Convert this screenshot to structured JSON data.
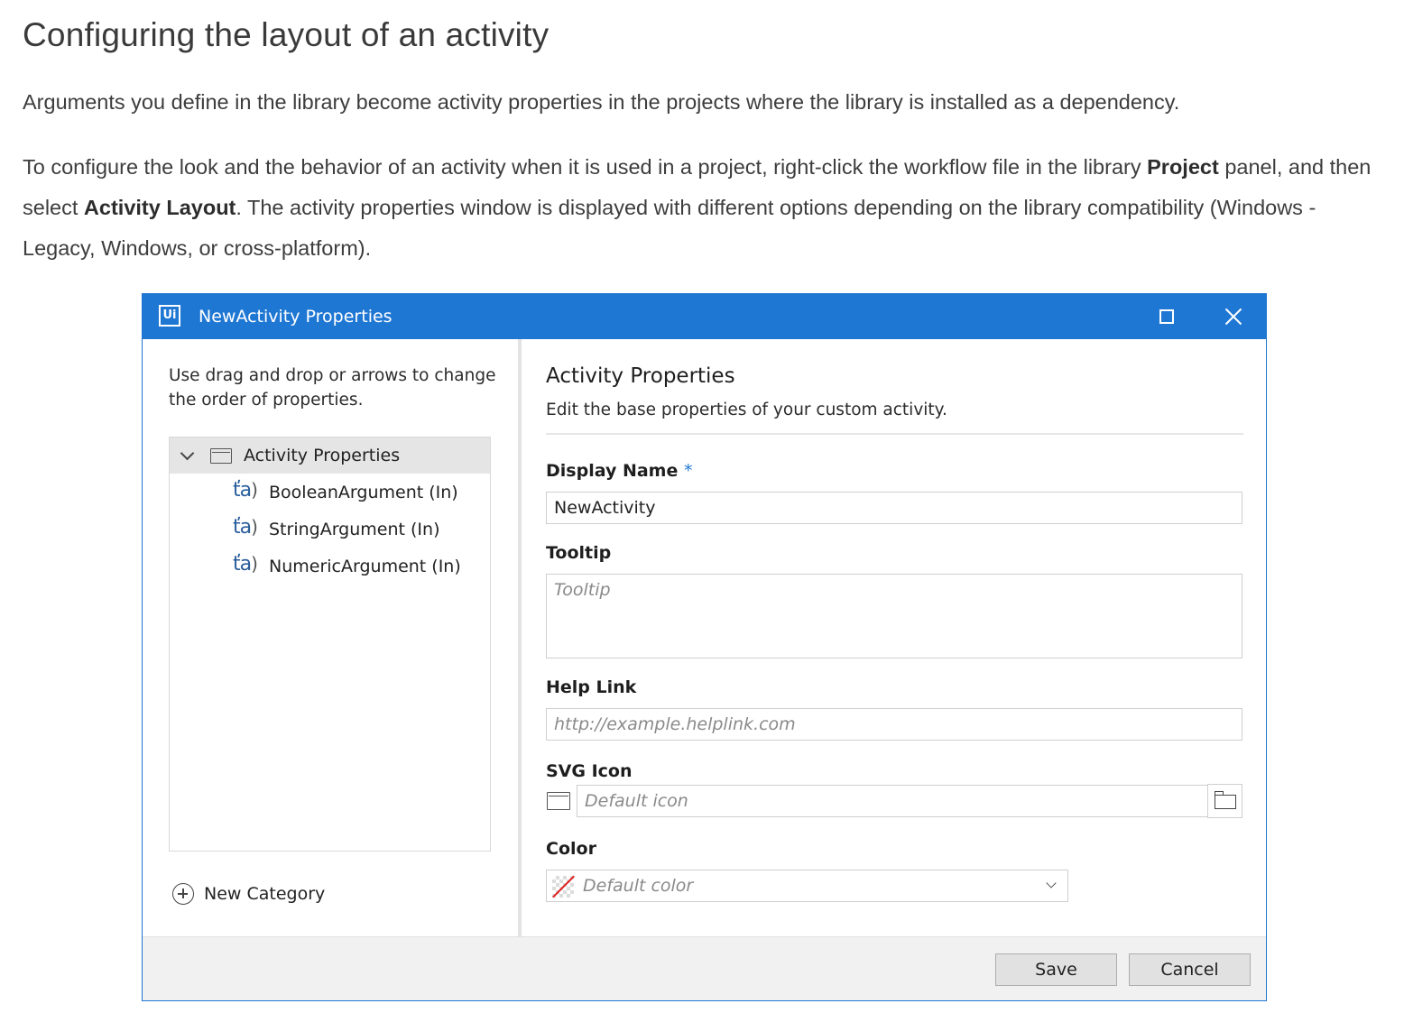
{
  "article": {
    "title": "Configuring the layout of an activity",
    "para1": "Arguments you define in the library become activity properties in the projects where the library is installed as a dependency.",
    "para2": {
      "text_a": "To configure the look and the behavior of an activity when it is used in a project, right-click the workflow file in the library ",
      "bold_a": "Project",
      "text_b": " panel, and then select ",
      "bold_b": "Activity Layout",
      "text_c": ". The activity properties window is displayed with different options depending on the library compatibility (Windows - Legacy, Windows, or cross-platform)."
    }
  },
  "dialog": {
    "app_logo": "Ui",
    "title": "NewActivity Properties",
    "left_pane": {
      "hint": "Use drag and drop or arrows to change the order of properties.",
      "tree_root": "Activity Properties",
      "arg_icon_glyph": "ťa",
      "items": [
        {
          "label": "BooleanArgument (In)"
        },
        {
          "label": "StringArgument (In)"
        },
        {
          "label": "NumericArgument (In)"
        }
      ],
      "new_category": "New Category"
    },
    "right_pane": {
      "heading": "Activity Properties",
      "subheading": "Edit the base properties of your custom activity.",
      "display_name": {
        "label": "Display Name",
        "required_mark": "*",
        "value": "NewActivity"
      },
      "tooltip": {
        "label": "Tooltip",
        "placeholder": "Tooltip"
      },
      "help_link": {
        "label": "Help Link",
        "placeholder": "http://example.helplink.com"
      },
      "svg_icon": {
        "label": "SVG Icon",
        "placeholder": "Default icon"
      },
      "color": {
        "label": "Color",
        "placeholder": "Default color"
      }
    },
    "footer": {
      "save": "Save",
      "cancel": "Cancel"
    }
  },
  "colors": {
    "titlebar": "#1f77d4",
    "accent": "#1f77d4"
  }
}
